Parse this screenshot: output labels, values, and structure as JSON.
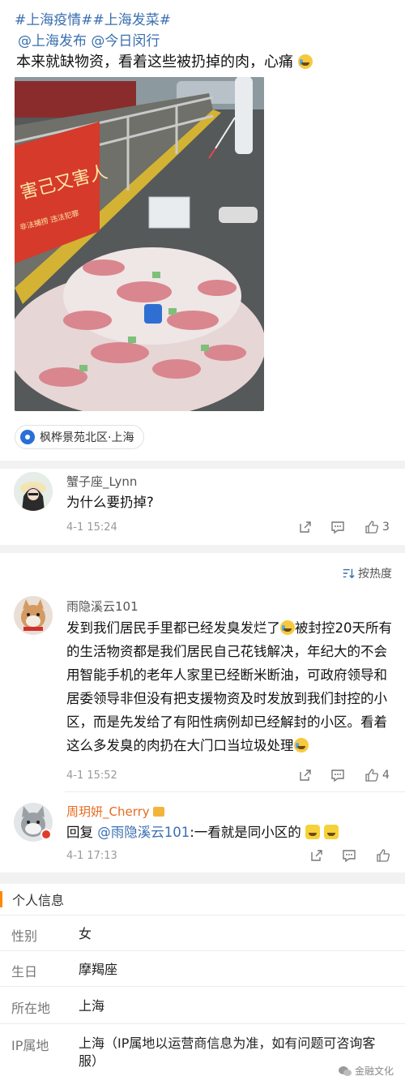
{
  "post": {
    "hashtags": "#上海疫情##上海发菜#",
    "mentions": "@上海发布 @今日闵行",
    "text": "本来就缺物资，看着这些被扔掉的肉，心痛",
    "location": "枫桦景苑北区·上海"
  },
  "comments": [
    {
      "user": "蟹子座_Lynn",
      "text": "为什么要扔掉?",
      "time": "4-1 15:24",
      "likes": "3"
    }
  ],
  "sort_label": "按热度",
  "hot_comments": [
    {
      "user": "雨隐溪云101",
      "text": "发到我们居民手里都已经发臭发烂了",
      "text2": "被封控20天所有的生活物资都是我们居民自己花钱解决，年纪大的不会用智能手机的老年人家里已经断米断油，可政府领导和居委领导非但没有把支援物资及时发放到我们封控的小区，而是先发给了有阳性病例却已经解封的小区。看着这么多发臭的肉扔在大门口当垃圾处理",
      "time": "4-1 15:52",
      "likes": "4"
    },
    {
      "user": "周玥妍_Cherry",
      "reply_prefix": "回复",
      "reply_to": "@雨隐溪云101",
      "text": ":一看就是同小区的",
      "time": "4-1 17:13"
    }
  ],
  "profile": {
    "title": "个人信息",
    "rows": [
      {
        "label": "性别",
        "value": "女"
      },
      {
        "label": "生日",
        "value": "摩羯座"
      },
      {
        "label": "所在地",
        "value": "上海"
      },
      {
        "label": "IP属地",
        "value": "上海（IP属地以运营商信息为准，如有问题可咨询客服）"
      }
    ]
  },
  "watermark": "金融文化",
  "colors": {
    "link": "#3a6fb0",
    "accent": "#ff8a00",
    "highlight": "#e86a1f"
  }
}
